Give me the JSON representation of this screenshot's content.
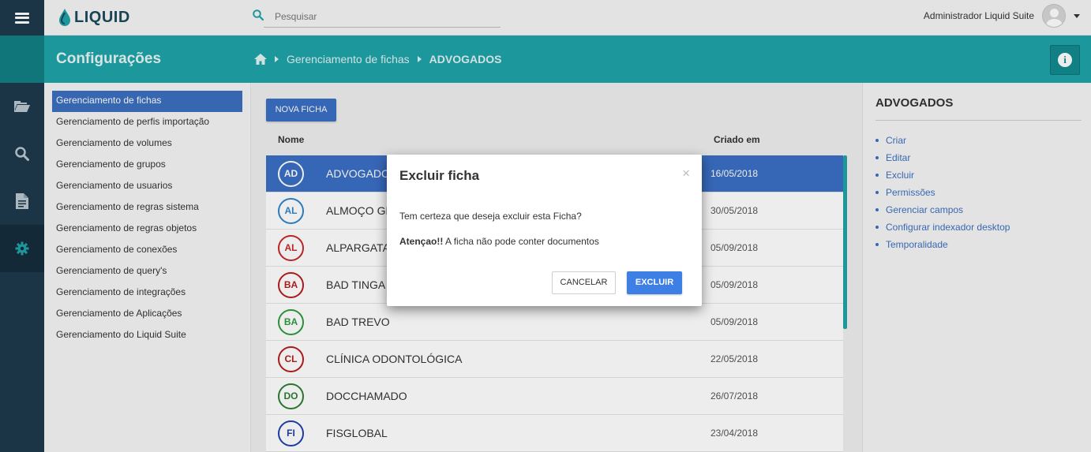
{
  "app": {
    "logo_text": "LIQUID",
    "search_placeholder": "Pesquisar",
    "user_name": "Administrador Liquid Suite"
  },
  "header": {
    "title": "Configurações",
    "breadcrumb": [
      "Gerenciamento de fichas",
      "ADVOGADOS"
    ]
  },
  "iconnav": [
    {
      "icon": "folder-open-icon"
    },
    {
      "icon": "search-icon"
    },
    {
      "icon": "document-icon"
    },
    {
      "icon": "gear-icon",
      "active": true
    }
  ],
  "submenu": {
    "items": [
      {
        "label": "Gerenciamento de fichas",
        "active": true
      },
      {
        "label": "Gerenciamento de perfis importação"
      },
      {
        "label": "Gerenciamento de volumes"
      },
      {
        "label": "Gerenciamento de grupos"
      },
      {
        "label": "Gerenciamento de usuarios"
      },
      {
        "label": "Gerenciamento de regras sistema"
      },
      {
        "label": "Gerenciamento de regras objetos"
      },
      {
        "label": "Gerenciamento de conexões"
      },
      {
        "label": "Gerenciamento de query's"
      },
      {
        "label": "Gerenciamento de integrações"
      },
      {
        "label": "Gerenciamento de Aplicações"
      },
      {
        "label": "Gerenciamento do Liquid Suite"
      }
    ]
  },
  "main": {
    "new_button": "NOVA FICHA",
    "columns": {
      "name": "Nome",
      "date": "Criado em"
    },
    "rows": [
      {
        "initials": "AD",
        "name": "ADVOGADOS",
        "date": "16/05/2018",
        "color": "#3b6ec4",
        "selected": true
      },
      {
        "initials": "AL",
        "name": "ALMOÇO GR",
        "date": "30/05/2018",
        "color": "#2f86c9"
      },
      {
        "initials": "AL",
        "name": "ALPARGATA",
        "date": "05/09/2018",
        "color": "#c62828"
      },
      {
        "initials": "BA",
        "name": "BAD TINGA",
        "date": "05/09/2018",
        "color": "#b71c1c"
      },
      {
        "initials": "BA",
        "name": "BAD TREVO",
        "date": "05/09/2018",
        "color": "#2e9a3e"
      },
      {
        "initials": "CL",
        "name": "CLÍNICA ODONTOLÓGICA",
        "date": "22/05/2018",
        "color": "#b71c1c"
      },
      {
        "initials": "DO",
        "name": "DOCCHAMADO",
        "date": "26/07/2018",
        "color": "#2e7d32"
      },
      {
        "initials": "FI",
        "name": "FISGLOBAL",
        "date": "23/04/2018",
        "color": "#1e40b0"
      }
    ]
  },
  "rpanel": {
    "title": "ADVOGADOS",
    "links": [
      "Criar",
      "Editar",
      "Excluir",
      "Permissões",
      "Gerenciar campos",
      "Configurar indexador desktop",
      "Temporalidade"
    ]
  },
  "modal": {
    "title": "Excluir ficha",
    "close": "×",
    "question": "Tem certeza que deseja excluir esta Ficha?",
    "warning_strong": "Atençao!!",
    "warning_text": " A ficha não pode conter documentos",
    "cancel_label": "CANCELAR",
    "confirm_label": "EXCLUIR"
  },
  "colors": {
    "nav_dark": "#1e3a4c",
    "teal": "#1fa3a8",
    "primary": "#3b6ec4",
    "delete_button": "#3e7fe6"
  }
}
